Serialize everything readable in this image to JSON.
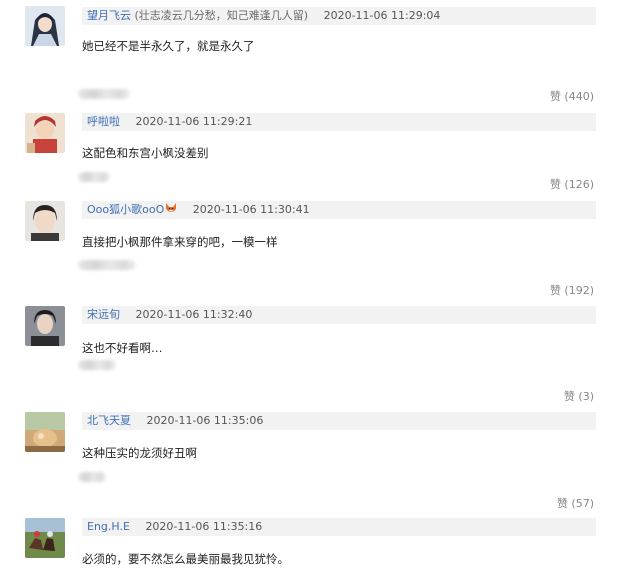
{
  "comments": [
    {
      "user": "望月飞云",
      "signature": "(壮志凌云几分愁，知己难逢几人留)",
      "time": "2020-11-06 11:29:04",
      "text": "她已经不是半永久了，就是永久了",
      "like_label": "赞 (440)",
      "avatar": "anime-avatar-blue"
    },
    {
      "user": "呼啦啦",
      "signature": "",
      "time": "2020-11-06 11:29:21",
      "text": "这配色和东宫小枫没差别",
      "like_label": "赞 (126)",
      "avatar": "cartoon-avatar-red"
    },
    {
      "user": "Ooo狐小歌ooO",
      "signature": "",
      "time": "2020-11-06 11:30:41",
      "text": "直接把小枫那件拿来穿的吧，一模一样",
      "like_label": "赞 (192)",
      "avatar": "portrait-avatar",
      "badge": "fox-emoji-icon"
    },
    {
      "user": "宋远旬",
      "signature": "",
      "time": "2020-11-06 11:32:40",
      "text": "这也不好看啊…",
      "like_label": "赞 (3)",
      "avatar": "photo-avatar-dark"
    },
    {
      "user": "北飞天夏",
      "signature": "",
      "time": "2020-11-06 11:35:06",
      "text": "这种压实的龙须好丑啊",
      "like_label": "赞 (57)",
      "avatar": "photo-avatar-tan"
    },
    {
      "user": "Eng.H.E",
      "signature": "",
      "time": "2020-11-06 11:35:16",
      "text": "必须的，要不然怎么最美丽最我见犹怜。",
      "like_label": "",
      "avatar": "horse-race-avatar"
    }
  ],
  "colors": {
    "username": "#3d6fb5",
    "meta_bg": "#f2f2f2",
    "like": "#888888"
  }
}
